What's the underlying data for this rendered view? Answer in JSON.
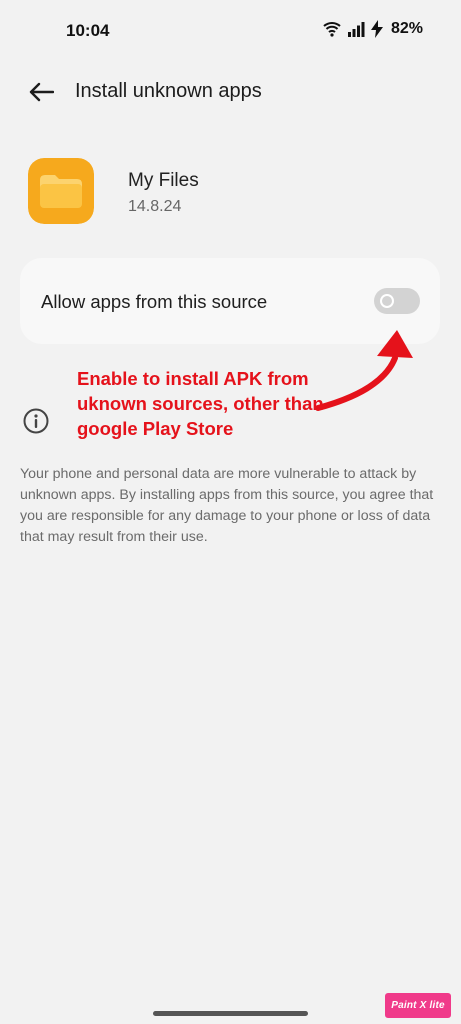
{
  "status_bar": {
    "time": "10:04",
    "battery": "82%",
    "icons": [
      "wifi-icon",
      "signal-icon",
      "charging-icon"
    ]
  },
  "app_bar": {
    "title": "Install unknown apps",
    "back_icon": "arrow-left-icon"
  },
  "app": {
    "name": "My Files",
    "version": "14.8.24",
    "icon": "folder-icon",
    "icon_color": "#f6a91d"
  },
  "setting": {
    "label": "Allow apps from this source",
    "enabled": false
  },
  "annotation": {
    "text": "Enable to install APK from uknown sources, other than google Play Store",
    "color": "#e5121b"
  },
  "info": {
    "icon": "info-icon",
    "text": "Your phone and personal data are more vulnerable to attack by unknown apps. By installing apps from this source, you agree that you are responsible for any damage to your phone or loss of data that may result from their use."
  },
  "watermark": {
    "text": "Paint X lite"
  }
}
